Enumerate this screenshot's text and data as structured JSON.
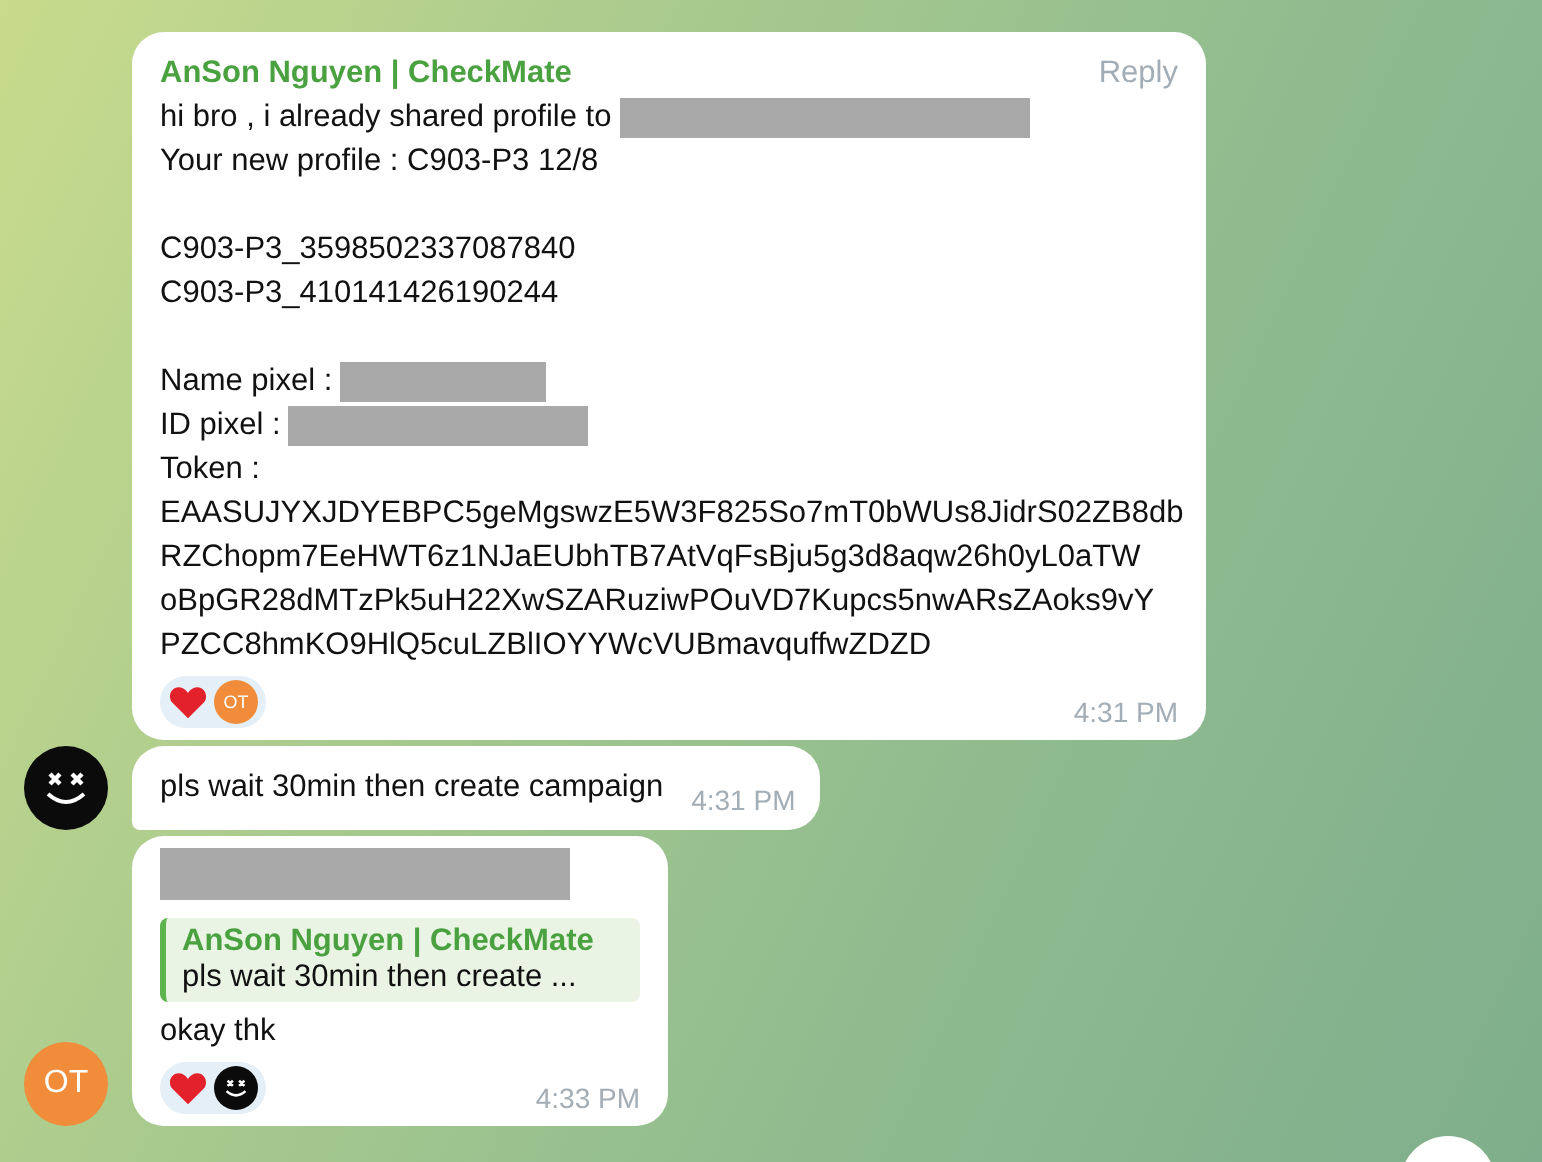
{
  "messages": [
    {
      "kind": "full",
      "sender": "AnSon Nguyen | CheckMate",
      "reply_label": "Reply",
      "lines": [
        {
          "kind": "text",
          "text": "hi bro , i already shared profile to",
          "redacted": true
        },
        {
          "kind": "text",
          "text": "Your new profile : C903-P3 12/8",
          "redacted": false
        },
        {
          "kind": "gap"
        },
        {
          "kind": "text",
          "text": "C903-P3_3598502337087840",
          "redacted": false
        },
        {
          "kind": "text",
          "text": "C903-P3_410141426190244",
          "redacted": false
        },
        {
          "kind": "gap"
        },
        {
          "kind": "text",
          "text": "Name pixel :",
          "redacted": true
        },
        {
          "kind": "text",
          "text": "ID pixel :",
          "redacted": true
        },
        {
          "kind": "text",
          "text": "Token :",
          "redacted": false
        },
        {
          "kind": "text",
          "text": "EAASUJYXJDYEBPC5geMgswzE5W3F825So7mT0bWUs8JidrS02ZB8db",
          "redacted": false
        },
        {
          "kind": "text",
          "text": "RZChopm7EeHWT6z1NJaEUbhTB7AtVqFsBju5g3d8aqw26h0yL0aTW",
          "redacted": false
        },
        {
          "kind": "text",
          "text": "oBpGR28dMTzPk5uH22XwSZARuziwPOuVD7Kupcs5nwARsZAoks9vY",
          "redacted": false
        },
        {
          "kind": "text",
          "text": "PZCC8hmKO9HlQ5cuLZBlIOYYWcVUBmavquffwZDZD",
          "redacted": false
        }
      ],
      "reactions": [
        {
          "kind": "heart"
        },
        {
          "kind": "initials",
          "initials": "OT"
        }
      ],
      "time": "4:31 PM"
    },
    {
      "kind": "short",
      "avatar": {
        "kind": "face"
      },
      "text": "pls wait 30min then create campaign",
      "time": "4:31 PM"
    },
    {
      "kind": "quoted",
      "redacted_header": true,
      "quote": {
        "sender": "AnSon Nguyen | CheckMate",
        "text": "pls wait 30min then create ..."
      },
      "text": "okay thk",
      "reactions": [
        {
          "kind": "heart"
        },
        {
          "kind": "face"
        }
      ],
      "time": "4:33 PM",
      "avatar": {
        "kind": "initials",
        "initials": "OT"
      }
    }
  ]
}
